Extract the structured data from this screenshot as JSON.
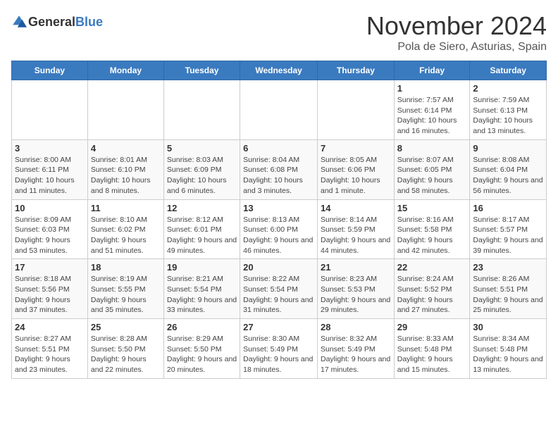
{
  "header": {
    "logo_general": "General",
    "logo_blue": "Blue",
    "month_year": "November 2024",
    "location": "Pola de Siero, Asturias, Spain"
  },
  "calendar": {
    "weekdays": [
      "Sunday",
      "Monday",
      "Tuesday",
      "Wednesday",
      "Thursday",
      "Friday",
      "Saturday"
    ],
    "weeks": [
      [
        {
          "day": "",
          "info": ""
        },
        {
          "day": "",
          "info": ""
        },
        {
          "day": "",
          "info": ""
        },
        {
          "day": "",
          "info": ""
        },
        {
          "day": "",
          "info": ""
        },
        {
          "day": "1",
          "info": "Sunrise: 7:57 AM\nSunset: 6:14 PM\nDaylight: 10 hours and 16 minutes."
        },
        {
          "day": "2",
          "info": "Sunrise: 7:59 AM\nSunset: 6:13 PM\nDaylight: 10 hours and 13 minutes."
        }
      ],
      [
        {
          "day": "3",
          "info": "Sunrise: 8:00 AM\nSunset: 6:11 PM\nDaylight: 10 hours and 11 minutes."
        },
        {
          "day": "4",
          "info": "Sunrise: 8:01 AM\nSunset: 6:10 PM\nDaylight: 10 hours and 8 minutes."
        },
        {
          "day": "5",
          "info": "Sunrise: 8:03 AM\nSunset: 6:09 PM\nDaylight: 10 hours and 6 minutes."
        },
        {
          "day": "6",
          "info": "Sunrise: 8:04 AM\nSunset: 6:08 PM\nDaylight: 10 hours and 3 minutes."
        },
        {
          "day": "7",
          "info": "Sunrise: 8:05 AM\nSunset: 6:06 PM\nDaylight: 10 hours and 1 minute."
        },
        {
          "day": "8",
          "info": "Sunrise: 8:07 AM\nSunset: 6:05 PM\nDaylight: 9 hours and 58 minutes."
        },
        {
          "day": "9",
          "info": "Sunrise: 8:08 AM\nSunset: 6:04 PM\nDaylight: 9 hours and 56 minutes."
        }
      ],
      [
        {
          "day": "10",
          "info": "Sunrise: 8:09 AM\nSunset: 6:03 PM\nDaylight: 9 hours and 53 minutes."
        },
        {
          "day": "11",
          "info": "Sunrise: 8:10 AM\nSunset: 6:02 PM\nDaylight: 9 hours and 51 minutes."
        },
        {
          "day": "12",
          "info": "Sunrise: 8:12 AM\nSunset: 6:01 PM\nDaylight: 9 hours and 49 minutes."
        },
        {
          "day": "13",
          "info": "Sunrise: 8:13 AM\nSunset: 6:00 PM\nDaylight: 9 hours and 46 minutes."
        },
        {
          "day": "14",
          "info": "Sunrise: 8:14 AM\nSunset: 5:59 PM\nDaylight: 9 hours and 44 minutes."
        },
        {
          "day": "15",
          "info": "Sunrise: 8:16 AM\nSunset: 5:58 PM\nDaylight: 9 hours and 42 minutes."
        },
        {
          "day": "16",
          "info": "Sunrise: 8:17 AM\nSunset: 5:57 PM\nDaylight: 9 hours and 39 minutes."
        }
      ],
      [
        {
          "day": "17",
          "info": "Sunrise: 8:18 AM\nSunset: 5:56 PM\nDaylight: 9 hours and 37 minutes."
        },
        {
          "day": "18",
          "info": "Sunrise: 8:19 AM\nSunset: 5:55 PM\nDaylight: 9 hours and 35 minutes."
        },
        {
          "day": "19",
          "info": "Sunrise: 8:21 AM\nSunset: 5:54 PM\nDaylight: 9 hours and 33 minutes."
        },
        {
          "day": "20",
          "info": "Sunrise: 8:22 AM\nSunset: 5:54 PM\nDaylight: 9 hours and 31 minutes."
        },
        {
          "day": "21",
          "info": "Sunrise: 8:23 AM\nSunset: 5:53 PM\nDaylight: 9 hours and 29 minutes."
        },
        {
          "day": "22",
          "info": "Sunrise: 8:24 AM\nSunset: 5:52 PM\nDaylight: 9 hours and 27 minutes."
        },
        {
          "day": "23",
          "info": "Sunrise: 8:26 AM\nSunset: 5:51 PM\nDaylight: 9 hours and 25 minutes."
        }
      ],
      [
        {
          "day": "24",
          "info": "Sunrise: 8:27 AM\nSunset: 5:51 PM\nDaylight: 9 hours and 23 minutes."
        },
        {
          "day": "25",
          "info": "Sunrise: 8:28 AM\nSunset: 5:50 PM\nDaylight: 9 hours and 22 minutes."
        },
        {
          "day": "26",
          "info": "Sunrise: 8:29 AM\nSunset: 5:50 PM\nDaylight: 9 hours and 20 minutes."
        },
        {
          "day": "27",
          "info": "Sunrise: 8:30 AM\nSunset: 5:49 PM\nDaylight: 9 hours and 18 minutes."
        },
        {
          "day": "28",
          "info": "Sunrise: 8:32 AM\nSunset: 5:49 PM\nDaylight: 9 hours and 17 minutes."
        },
        {
          "day": "29",
          "info": "Sunrise: 8:33 AM\nSunset: 5:48 PM\nDaylight: 9 hours and 15 minutes."
        },
        {
          "day": "30",
          "info": "Sunrise: 8:34 AM\nSunset: 5:48 PM\nDaylight: 9 hours and 13 minutes."
        }
      ]
    ]
  }
}
